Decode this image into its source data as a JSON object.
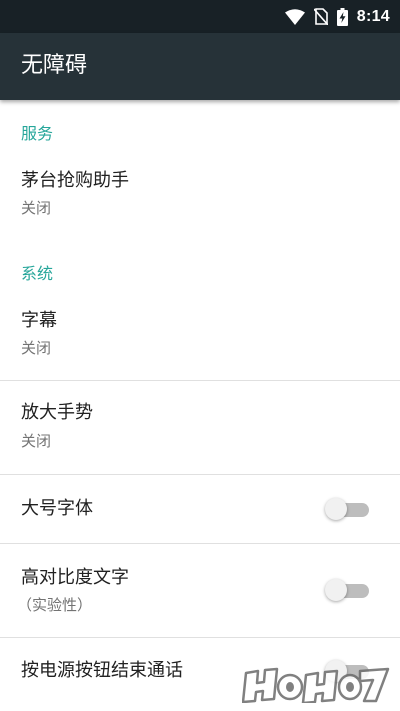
{
  "status_bar": {
    "time": "8:14",
    "icons": [
      "wifi-icon",
      "no-sim-icon",
      "battery-charging-icon"
    ]
  },
  "app_bar": {
    "title": "无障碍"
  },
  "sections": [
    {
      "header": "服务",
      "items": [
        {
          "title": "茅台抢购助手",
          "summary": "关闭"
        }
      ]
    },
    {
      "header": "系统",
      "items": [
        {
          "title": "字幕",
          "summary": "关闭"
        },
        {
          "title": "放大手势",
          "summary": "关闭"
        },
        {
          "title": "大号字体",
          "switch": false
        },
        {
          "title": "高对比度文字",
          "summary": "（实验性）",
          "switch": false
        },
        {
          "title": "按电源按钮结束通话",
          "switch": false
        }
      ]
    }
  ],
  "colors": {
    "accent": "#26A69A",
    "app_bar": "#263238",
    "status_bar": "#182126"
  }
}
